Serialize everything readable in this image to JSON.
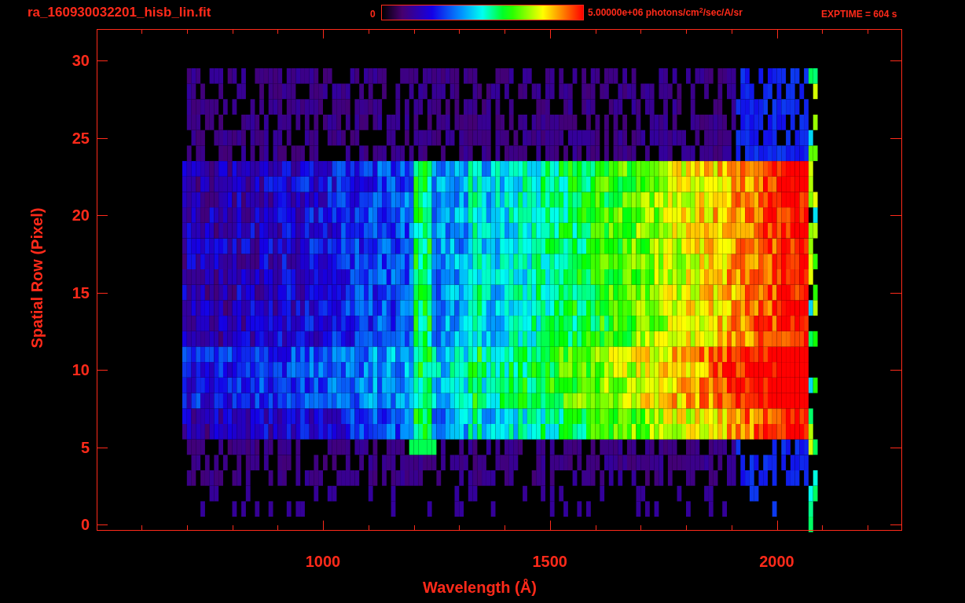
{
  "title": "ra_160930032201_hisb_lin.fit",
  "colorbar": {
    "min_label": "0",
    "max_label": "5.00000e+06 photons/cm$^{2}$/sec/A/sr"
  },
  "exposure": "EXPTIME = 604 s",
  "plot": {
    "xlabel": "Wavelength (Å)",
    "ylabel": "Spatial Row (Pixel)",
    "xticks": [
      "1000",
      "1500",
      "2000"
    ],
    "yticks": [
      "30",
      "25",
      "20",
      "15",
      "10",
      "5",
      "0"
    ]
  }
}
